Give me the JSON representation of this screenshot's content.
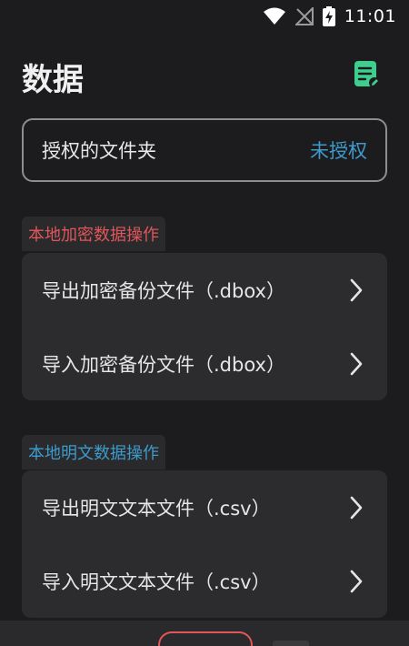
{
  "status_bar": {
    "time": "11:01"
  },
  "header": {
    "title": "数据"
  },
  "folder": {
    "label": "授权的文件夹",
    "status": "未授权"
  },
  "sections": [
    {
      "tag": "本地加密数据操作",
      "items": [
        {
          "label": "导出加密备份文件（.dbox）"
        },
        {
          "label": "导入加密备份文件（.dbox）"
        }
      ]
    },
    {
      "tag": "本地明文数据操作",
      "items": [
        {
          "label": "导出明文文本文件（.csv）"
        },
        {
          "label": "导入明文文本文件（.csv）"
        }
      ]
    }
  ],
  "colors": {
    "background": "#1c1c1e",
    "card": "#2c2c2e",
    "accent_blue": "#3d9bcc",
    "accent_red": "#e0565a",
    "note_icon": "#3ecf8e"
  },
  "icons": {
    "wifi": "wifi-icon",
    "signal": "no-signal-icon",
    "battery": "battery-charging-icon",
    "note": "note-edit-icon",
    "chevron": "chevron-right-icon"
  }
}
